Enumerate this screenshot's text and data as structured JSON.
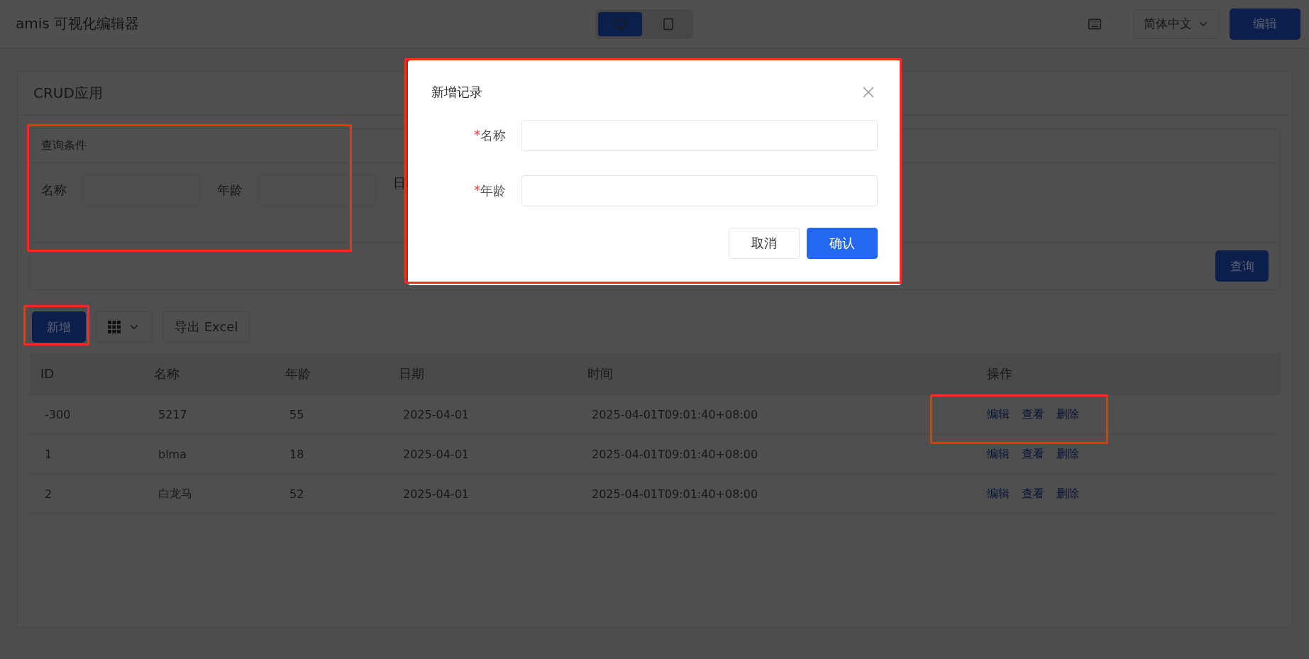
{
  "header": {
    "title": "amis 可视化编辑器",
    "devices": [
      {
        "kind": "desktop",
        "selected": true
      },
      {
        "kind": "tablet",
        "selected": false
      }
    ],
    "language": "简体中文",
    "edit_button": "编辑"
  },
  "page": {
    "title": "CRUD应用",
    "filter": {
      "title": "查询条件",
      "fields": [
        {
          "label": "名称"
        },
        {
          "label": "年龄"
        },
        {
          "label": "日"
        }
      ],
      "submit": "查询"
    },
    "toolbar": {
      "add": "新增",
      "export": "导出 Excel"
    },
    "table": {
      "columns": [
        "ID",
        "名称",
        "年龄",
        "日期",
        "时间",
        "操作"
      ],
      "rows": [
        {
          "cells": [
            "-300",
            "5217",
            "55",
            "2025-04-01",
            "2025-04-01T09:01:40+08:00"
          ],
          "actions": [
            "编辑",
            "查看",
            "删除"
          ]
        },
        {
          "cells": [
            "1",
            "blma",
            "18",
            "2025-04-01",
            "2025-04-01T09:01:40+08:00"
          ],
          "actions": [
            "编辑",
            "查看",
            "删除"
          ]
        },
        {
          "cells": [
            "2",
            "白龙马",
            "52",
            "2025-04-01",
            "2025-04-01T09:01:40+08:00"
          ],
          "actions": [
            "编辑",
            "查看",
            "删除"
          ]
        }
      ]
    }
  },
  "dialog": {
    "title": "新增记录",
    "fields": [
      {
        "mark": "*",
        "label": "名称"
      },
      {
        "mark": "*",
        "label": "年龄"
      }
    ],
    "buttons": [
      {
        "label": "取消",
        "kind": "default"
      },
      {
        "label": "确认",
        "kind": "primary"
      }
    ]
  }
}
